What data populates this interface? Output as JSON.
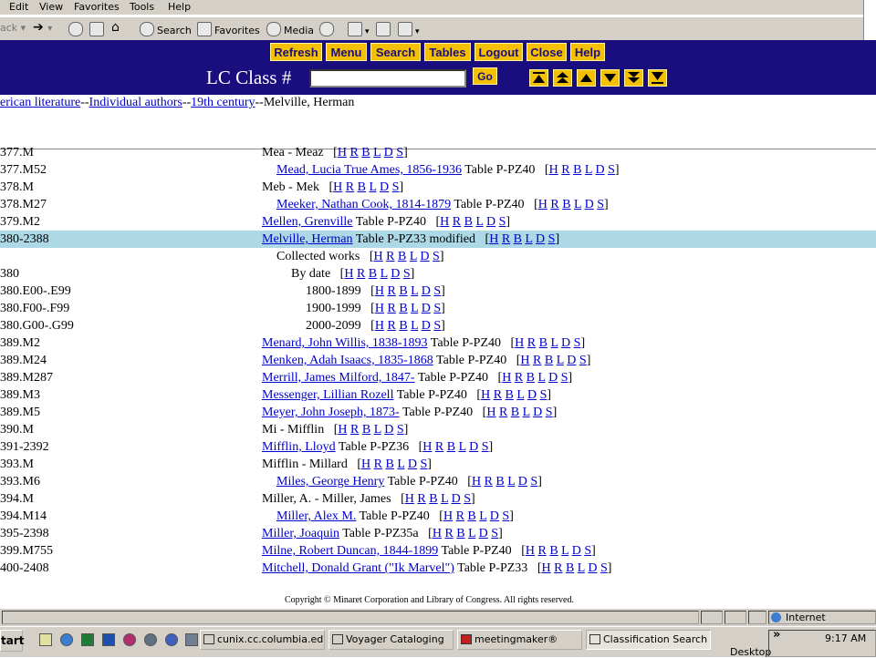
{
  "browser": {
    "menu": [
      "Edit",
      "View",
      "Favorites",
      "Tools",
      "Help"
    ],
    "toolbar": {
      "back": "ack",
      "search": "Search",
      "favorites": "Favorites",
      "media": "Media"
    }
  },
  "app": {
    "nav_buttons": [
      "Refresh",
      "Menu",
      "Search",
      "Tables",
      "Logout",
      "Close",
      "Help"
    ],
    "lc_label": "LC Class #",
    "lc_value": "",
    "go": "Go",
    "arrows": [
      "first-page-icon",
      "page-up-icon",
      "line-up-icon",
      "line-down-icon",
      "page-down-icon",
      "last-page-icon"
    ]
  },
  "breadcrumb": {
    "items": [
      "erican literature",
      "Individual authors",
      "19th century"
    ],
    "sep": "--",
    "current": "Melville, Herman"
  },
  "rows": [
    {
      "cls": "377.M",
      "indent": 0,
      "label": "Mea - Meaz",
      "link": false,
      "table": ""
    },
    {
      "cls": "377.M52",
      "indent": 1,
      "label": "Mead, Lucia True Ames, 1856-1936",
      "link": true,
      "table": "Table P-PZ40"
    },
    {
      "cls": "378.M",
      "indent": 0,
      "label": "Meb - Mek",
      "link": false,
      "table": ""
    },
    {
      "cls": "378.M27",
      "indent": 1,
      "label": "Meeker, Nathan Cook, 1814-1879",
      "link": true,
      "table": "Table P-PZ40"
    },
    {
      "cls": "379.M2",
      "indent": 0,
      "label": "Mellen, Grenville",
      "link": true,
      "table": "Table P-PZ40"
    },
    {
      "cls": "380-2388",
      "indent": 0,
      "label": "Melville, Herman",
      "link": true,
      "table": "Table P-PZ33 modified",
      "highlight": true
    },
    {
      "cls": "",
      "indent": 1,
      "label": "Collected works",
      "link": false,
      "table": ""
    },
    {
      "cls": "380",
      "indent": 2,
      "label": "By date",
      "link": false,
      "table": ""
    },
    {
      "cls": "380.E00-.E99",
      "indent": 3,
      "label": "1800-1899",
      "link": false,
      "table": ""
    },
    {
      "cls": "380.F00-.F99",
      "indent": 3,
      "label": "1900-1999",
      "link": false,
      "table": ""
    },
    {
      "cls": "380.G00-.G99",
      "indent": 3,
      "label": "2000-2099",
      "link": false,
      "table": ""
    },
    {
      "cls": "389.M2",
      "indent": 0,
      "label": "Menard, John Willis, 1838-1893",
      "link": true,
      "table": "Table P-PZ40"
    },
    {
      "cls": "389.M24",
      "indent": 0,
      "label": "Menken, Adah Isaacs, 1835-1868",
      "link": true,
      "table": "Table P-PZ40"
    },
    {
      "cls": "389.M287",
      "indent": 0,
      "label": "Merrill, James Milford, 1847-",
      "link": true,
      "table": "Table P-PZ40"
    },
    {
      "cls": "389.M3",
      "indent": 0,
      "label": "Messenger, Lillian Rozell",
      "link": true,
      "table": "Table P-PZ40"
    },
    {
      "cls": "389.M5",
      "indent": 0,
      "label": "Meyer, John Joseph, 1873-",
      "link": true,
      "table": "Table P-PZ40"
    },
    {
      "cls": "390.M",
      "indent": 0,
      "label": "Mi - Mifflin",
      "link": false,
      "table": ""
    },
    {
      "cls": "391-2392",
      "indent": 0,
      "label": "Mifflin, Lloyd",
      "link": true,
      "table": "Table P-PZ36"
    },
    {
      "cls": "393.M",
      "indent": 0,
      "label": "Mifflin - Millard",
      "link": false,
      "table": ""
    },
    {
      "cls": "393.M6",
      "indent": 1,
      "label": "Miles, George Henry",
      "link": true,
      "table": "Table P-PZ40"
    },
    {
      "cls": "394.M",
      "indent": 0,
      "label": "Miller, A. - Miller, James",
      "link": false,
      "table": ""
    },
    {
      "cls": "394.M14",
      "indent": 1,
      "label": "Miller, Alex M.",
      "link": true,
      "table": "Table P-PZ40"
    },
    {
      "cls": "395-2398",
      "indent": 0,
      "label": "Miller, Joaquin",
      "link": true,
      "table": "Table P-PZ35a"
    },
    {
      "cls": "399.M755",
      "indent": 0,
      "label": "Milne, Robert Duncan, 1844-1899",
      "link": true,
      "table": "Table P-PZ40"
    },
    {
      "cls": "400-2408",
      "indent": 0,
      "label": "Mitchell, Donald Grant (\"Ik Marvel\")",
      "link": true,
      "table": "Table P-PZ33"
    }
  ],
  "row_links": [
    "H",
    "R",
    "B",
    "L",
    "D",
    "S"
  ],
  "copyright": "Copyright © Minaret Corporation and Library of Congress.  All rights reserved.",
  "status": {
    "zone": "Internet"
  },
  "taskbar": {
    "start": "tart",
    "tasks": [
      "cunix.cc.columbia.ed...",
      "Voyager Cataloging",
      "meetingmaker®",
      "Classification Search ..."
    ],
    "chevron": "»",
    "desktop": "Desktop",
    "clock": "9:17 AM"
  },
  "colors": {
    "app_bg": "#1a0d7e",
    "button": "#f4c000",
    "highlight": "#add8e6",
    "link": "#0000cc"
  }
}
